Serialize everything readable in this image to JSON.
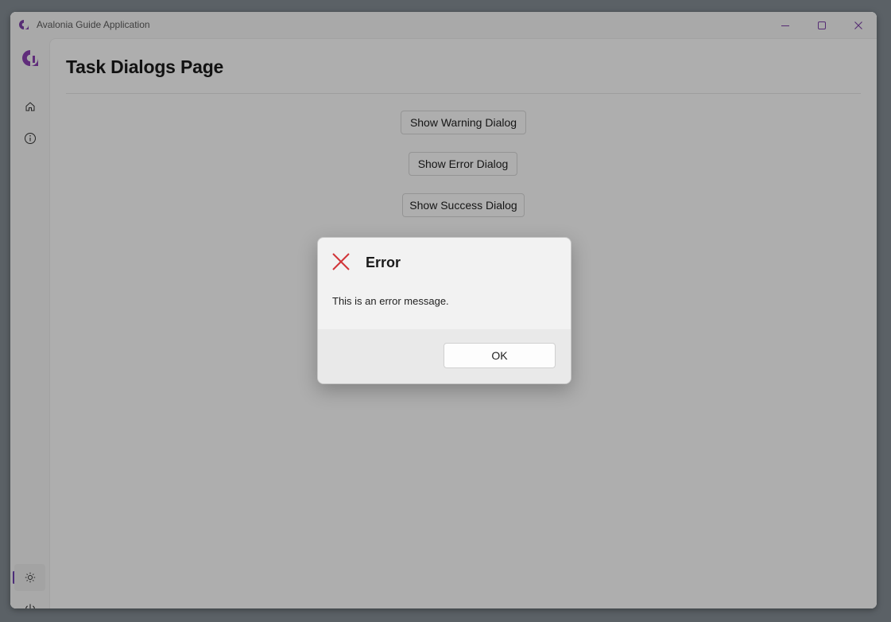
{
  "window": {
    "title": "Avalonia Guide Application",
    "accent_color": "#6d3fae"
  },
  "sidebar": {
    "items": [
      {
        "icon": "avalonia-logo-icon"
      },
      {
        "icon": "home-icon"
      },
      {
        "icon": "info-icon"
      },
      {
        "icon": "theme-sun-icon",
        "selected": true
      },
      {
        "icon": "power-icon"
      }
    ]
  },
  "page": {
    "title": "Task Dialogs Page",
    "buttons": [
      {
        "label": "Show Warning Dialog"
      },
      {
        "label": "Show Error Dialog"
      },
      {
        "label": "Show Success Dialog"
      }
    ]
  },
  "dialog": {
    "title": "Error",
    "message": "This is an error message.",
    "ok_label": "OK",
    "icon": "error-x-icon",
    "icon_color": "#d13438"
  }
}
